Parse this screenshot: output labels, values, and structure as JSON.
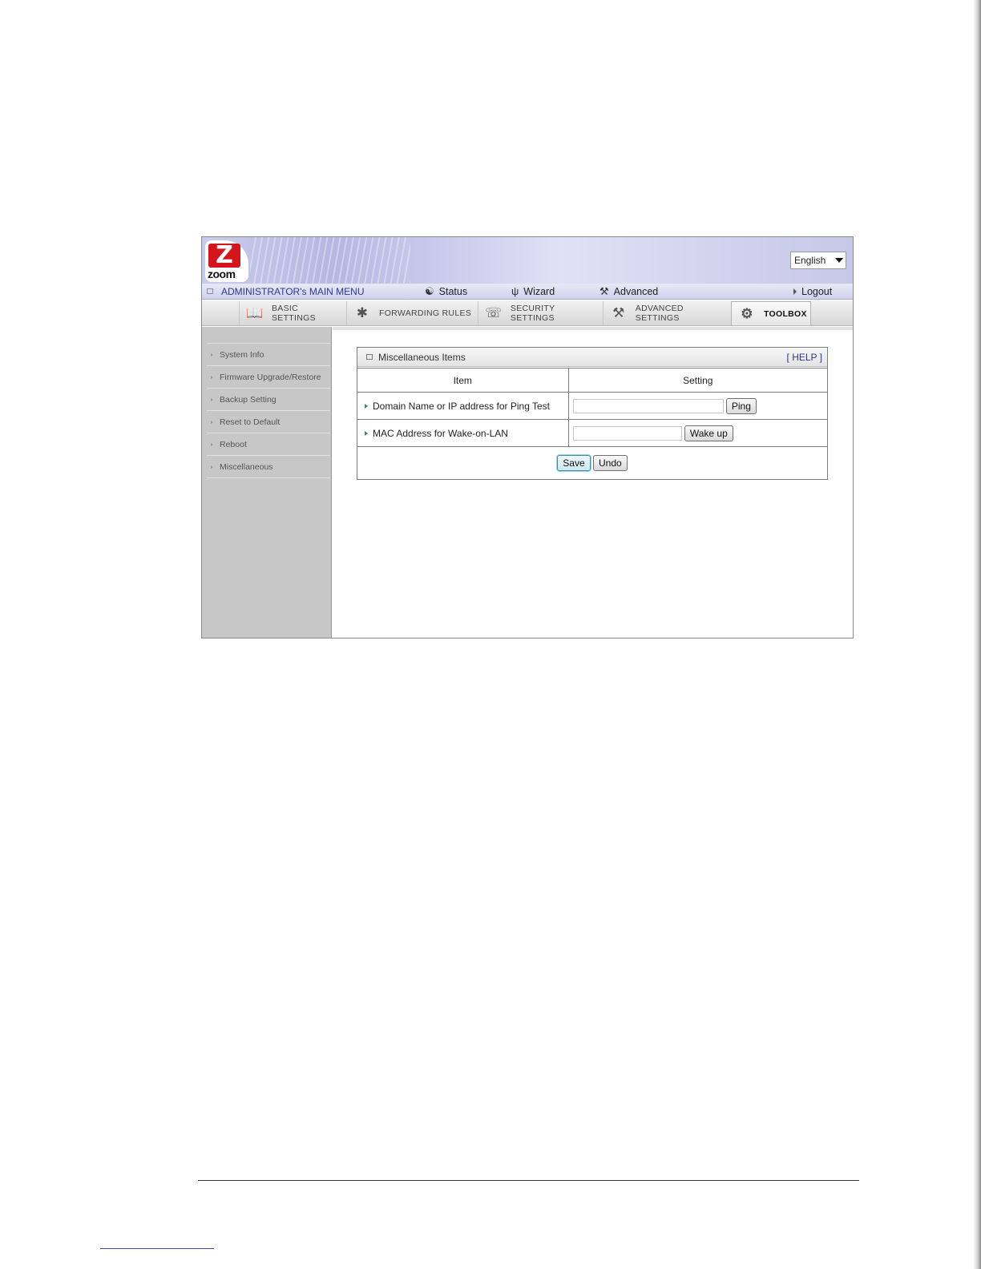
{
  "header": {
    "logo_text": "zoom",
    "language_select": {
      "selected": "English"
    }
  },
  "main_menu": {
    "title": "ADMINISTRATOR's MAIN MENU",
    "items": [
      {
        "label": "Status",
        "icon": "status-icon"
      },
      {
        "label": "Wizard",
        "icon": "wizard-icon"
      },
      {
        "label": "Advanced",
        "icon": "advanced-icon"
      }
    ],
    "logout_label": "Logout"
  },
  "tabs": [
    {
      "label": "BASIC SETTINGS",
      "icon": "basic-settings-icon",
      "active": false
    },
    {
      "label": "FORWARDING RULES",
      "icon": "forwarding-rules-icon",
      "active": false
    },
    {
      "label": "SECURITY SETTINGS",
      "icon": "security-settings-icon",
      "active": false
    },
    {
      "label": "ADVANCED SETTINGS",
      "icon": "advanced-settings-icon",
      "active": false
    },
    {
      "label": "TOOLBOX",
      "icon": "toolbox-icon",
      "active": true
    }
  ],
  "sidebar": {
    "items": [
      {
        "label": "System Info"
      },
      {
        "label": "Firmware Upgrade/Restore"
      },
      {
        "label": "Backup Setting"
      },
      {
        "label": "Reset to Default"
      },
      {
        "label": "Reboot"
      },
      {
        "label": "Miscellaneous"
      }
    ]
  },
  "panel": {
    "title": "Miscellaneous Items",
    "help_label": "[ HELP ]",
    "columns": {
      "item": "Item",
      "setting": "Setting"
    },
    "rows": [
      {
        "label": "Domain Name or IP address for Ping Test",
        "input_value": "",
        "button": "Ping"
      },
      {
        "label": "MAC Address for Wake-on-LAN",
        "input_value": "",
        "button": "Wake up"
      }
    ],
    "save_label": "Save",
    "undo_label": "Undo"
  },
  "colors": {
    "brand_red": "#d4161c",
    "menu_title_blue": "#2b3a8c",
    "row_arrow_green": "#2e8c74",
    "sidebar_gray": "#c7c7c7"
  }
}
